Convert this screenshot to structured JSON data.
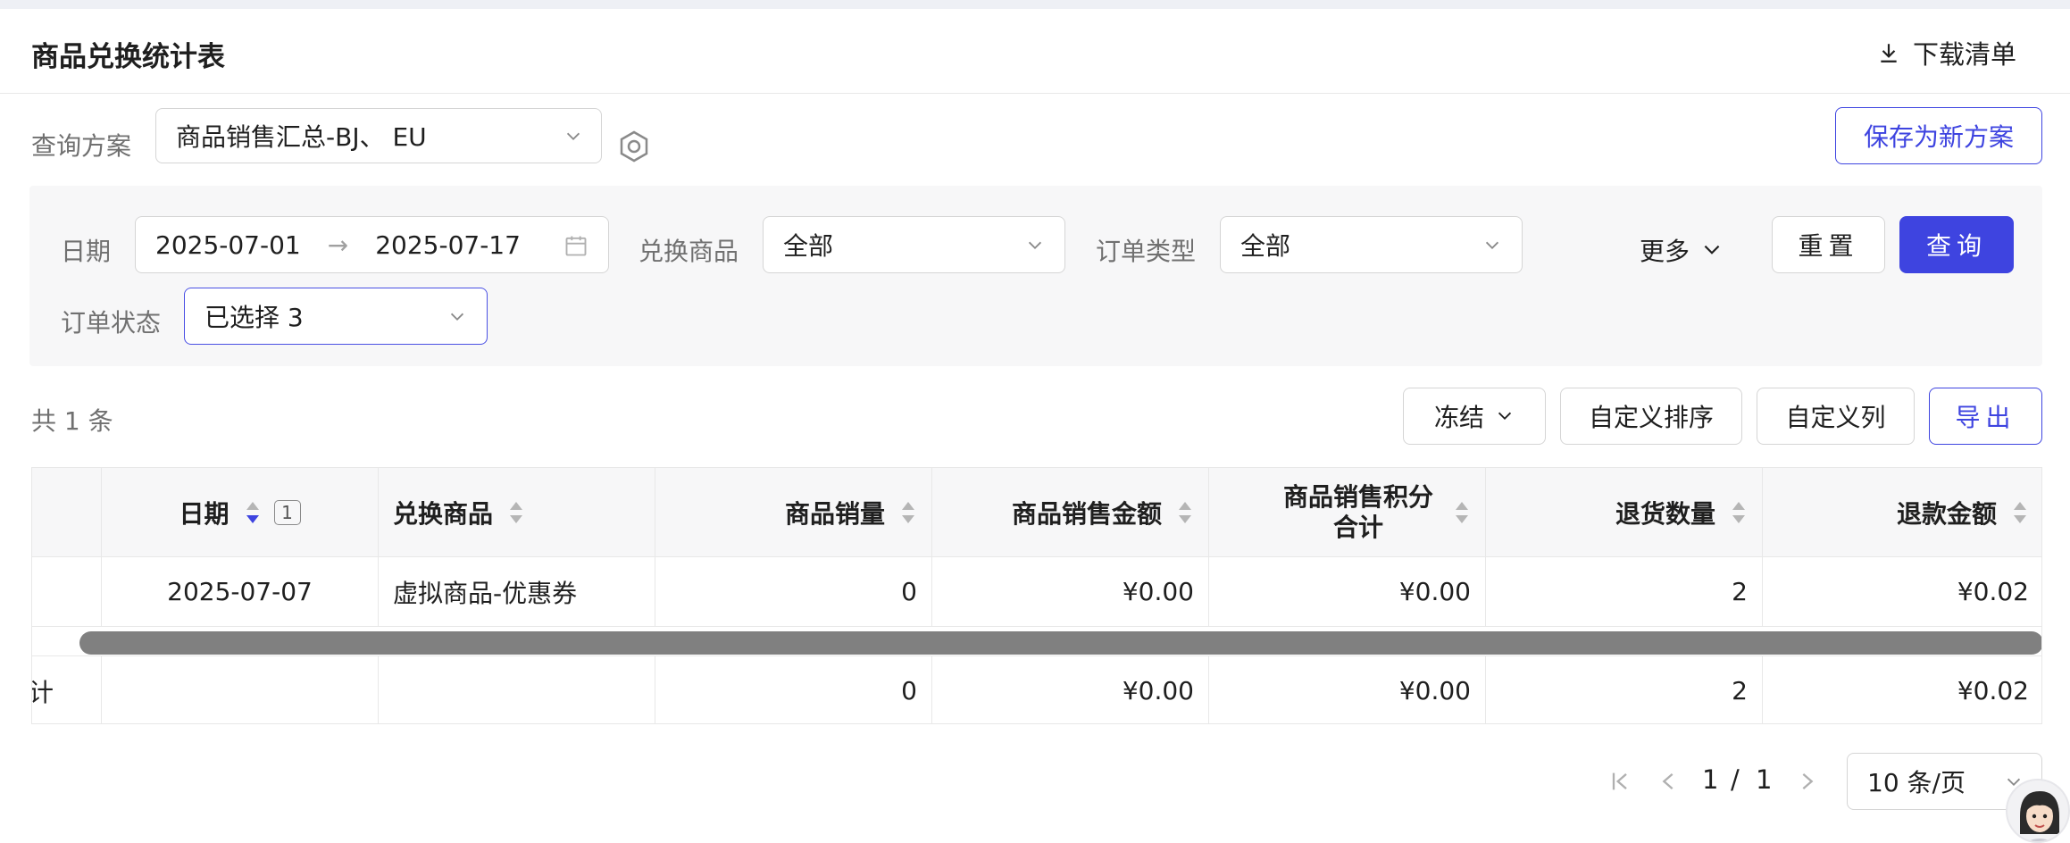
{
  "header": {
    "title": "商品兑换统计表",
    "download_label": "下载清单"
  },
  "scheme": {
    "label": "查询方案",
    "value": "商品销售汇总-BJ、 EU",
    "save_label": "保存为新方案"
  },
  "filters": {
    "date_label": "日期",
    "date_start": "2025-07-01",
    "date_sep": "→",
    "date_end": "2025-07-17",
    "product_label": "兑换商品",
    "product_value": "全部",
    "order_type_label": "订单类型",
    "order_type_value": "全部",
    "more_label": "更多",
    "reset_label": "重置",
    "query_label": "查询",
    "order_status_label": "订单状态",
    "order_status_value": "已选择 3"
  },
  "toolbar": {
    "total": "共 1 条",
    "freeze_label": "冻结",
    "custom_sort_label": "自定义排序",
    "custom_cols_label": "自定义列",
    "export_label": "导出"
  },
  "table": {
    "columns": [
      "日期",
      "兑换商品",
      "商品销量",
      "商品销售金额",
      "商品销售积分合计",
      "退货数量",
      "退款金额"
    ],
    "sort_badge": "1",
    "rows": [
      [
        "2025-07-07",
        "虚拟商品-优惠券",
        "0",
        "¥0.00",
        "¥0.00",
        "2",
        "¥0.02"
      ]
    ],
    "summary": {
      "label": "计",
      "values": [
        "",
        "",
        "0",
        "¥0.00",
        "¥0.00",
        "2",
        "¥0.02"
      ]
    }
  },
  "pagination": {
    "current": "1",
    "sep": "/",
    "total": "1",
    "page_size": "10 条/页"
  },
  "colors": {
    "primary": "#3e44e0",
    "border": "#d5d5d5",
    "panel": "#f7f7f8",
    "scrollbar": "#808080"
  }
}
